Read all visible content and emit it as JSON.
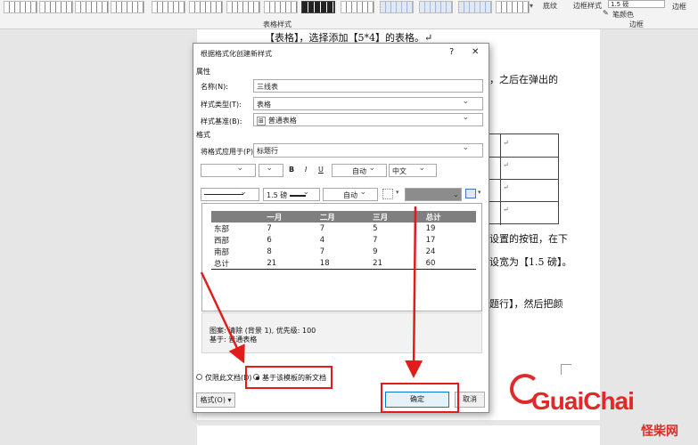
{
  "ribbon": {
    "group_table_styles": "表格样式",
    "shading_label": "底纹",
    "border_styles_label": "边框样式",
    "pen_color_label": "笔颜色",
    "borders_label": "边框",
    "borders_group_label": "边框",
    "pen_weight": "1.5 磅"
  },
  "document": {
    "line1": "【表格】，选择添加【5*4】的表格。↵",
    "line2_right": "，之后在弹出的",
    "line3_right": "设置的按钮，在下",
    "line4_right": "设宽为【1.5 磅】。",
    "line5_right": "题行】，然后把颜",
    "cell_mark": "↵"
  },
  "dialog": {
    "title": "根据格式化创建新样式",
    "help_label": "?",
    "close_label": "✕",
    "section_properties": "属性",
    "name_label": "名称(N):",
    "name_value": "三线表",
    "style_type_label": "样式类型(T):",
    "style_type_value": "表格",
    "style_based_on_label": "样式基准(B):",
    "style_based_on_value": "普通表格",
    "section_format": "格式",
    "apply_to_label": "将格式应用于(P):",
    "apply_to_value": "标题行",
    "bold_label": "B",
    "italic_label": "I",
    "underline_label": "U",
    "font_color_value": "自动",
    "script_value": "中文",
    "line_weight_value": "1.5 磅",
    "border_color_value": "自动",
    "preview": {
      "headers": [
        "",
        "一月",
        "二月",
        "三月",
        "总计"
      ],
      "rows": [
        [
          "东部",
          "7",
          "7",
          "5",
          "19"
        ],
        [
          "西部",
          "6",
          "4",
          "7",
          "17"
        ],
        [
          "南部",
          "8",
          "7",
          "9",
          "24"
        ],
        [
          "总计",
          "21",
          "18",
          "21",
          "60"
        ]
      ]
    },
    "description_line1": "图案: 清除 (背景 1), 优先级: 100",
    "description_line2": "基于: 普通表格",
    "radio_only_doc": "仅限此文档(D)",
    "radio_new_docs": "基于该模板的新文档",
    "format_button": "格式(O) ▾",
    "ok_button": "确定",
    "cancel_button": "取消"
  },
  "watermark": {
    "brand": "GuaiChai",
    "brand_cn": "怪柴网"
  },
  "colors": {
    "annotation_red": "#e21c1c",
    "preview_header": "#7f7f7f",
    "watermark_red": "#e02a2a"
  }
}
